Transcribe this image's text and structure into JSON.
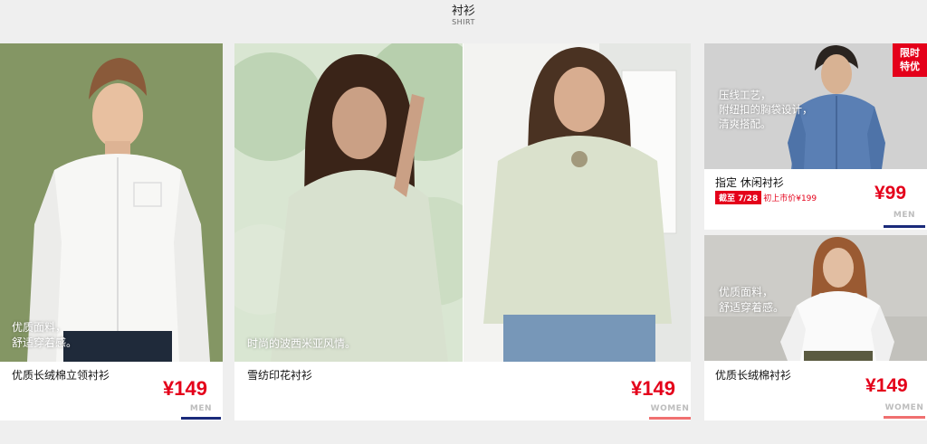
{
  "header": {
    "title": "衬衫",
    "subtitle": "SHIRT"
  },
  "colors": {
    "accent_red": "#e4001a",
    "men_underline": "#1a2a7a",
    "women_underline": "#f07070"
  },
  "products": [
    {
      "overlay": [
        "优质面料，",
        "舒适穿着感。"
      ],
      "name": "优质长绒棉立领衬衫",
      "price": "¥149",
      "gender": "MEN"
    },
    {
      "overlay": [
        "时尚的波西米亚风情。"
      ],
      "name": "雪纺印花衬衫",
      "price": "¥149",
      "gender": "WOMEN"
    },
    {
      "overlay": [
        "压线工艺，",
        "附纽扣的胸袋设计，",
        "清爽搭配。"
      ],
      "name": "指定 休闲衬衫",
      "price": "¥99",
      "gender": "MEN",
      "badge": [
        "限时",
        "特优"
      ],
      "promo_tag": "截至 7/28",
      "promo_was": "初上市价¥199"
    },
    {
      "overlay": [
        "优质面料，",
        "舒适穿着感。"
      ],
      "name": "优质长绒棉衬衫",
      "price": "¥149",
      "gender": "WOMEN"
    }
  ]
}
